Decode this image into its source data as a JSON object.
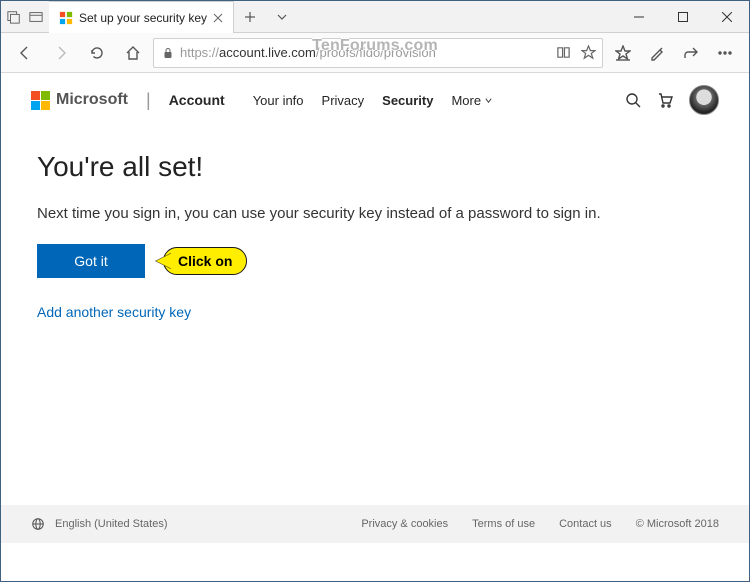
{
  "tab": {
    "title": "Set up your security key"
  },
  "address": {
    "scheme": "https://",
    "host": "account.live.com",
    "path": "/proofs/fido/provision"
  },
  "watermark": "TenForums.com",
  "header": {
    "brand": "Microsoft",
    "nav": {
      "account": "Account",
      "your_info": "Your info",
      "privacy": "Privacy",
      "security": "Security",
      "more": "More"
    }
  },
  "main": {
    "heading": "You're all set!",
    "description": "Next time you sign in, you can use your security key instead of a password to sign in.",
    "button_label": "Got it",
    "callout": "Click on",
    "add_link": "Add another security key"
  },
  "footer": {
    "locale": "English (United States)",
    "links": {
      "privacy": "Privacy & cookies",
      "terms": "Terms of use",
      "contact": "Contact us",
      "copyright": "© Microsoft 2018"
    }
  }
}
